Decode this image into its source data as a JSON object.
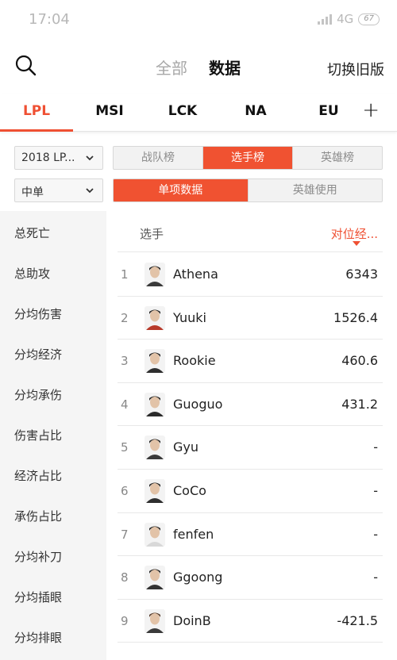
{
  "status_bar": {
    "time": "17:04",
    "network": "4G",
    "battery": "67"
  },
  "header": {
    "tab_all": "全部",
    "tab_data": "数据",
    "old_version": "切换旧版"
  },
  "league_tabs": [
    "LPL",
    "MSI",
    "LCK",
    "NA",
    "EU"
  ],
  "add_label": "+",
  "filters": {
    "season": "2018 LP...",
    "position": "中单",
    "ranking_tabs": [
      "战队榜",
      "选手榜",
      "英雄榜"
    ],
    "data_tabs": [
      "单项数据",
      "英雄使用"
    ]
  },
  "sidebar": {
    "items": [
      "总死亡",
      "总助攻",
      "分均伤害",
      "分均经济",
      "分均承伤",
      "伤害占比",
      "经济占比",
      "承伤占比",
      "分均补刀",
      "分均插眼",
      "分均排眼"
    ]
  },
  "table": {
    "col_player": "选手",
    "col_sort": "对位经...",
    "rows": [
      {
        "rank": "1",
        "name": "Athena",
        "value": "6343"
      },
      {
        "rank": "2",
        "name": "Yuuki",
        "value": "1526.4"
      },
      {
        "rank": "3",
        "name": "Rookie",
        "value": "460.6"
      },
      {
        "rank": "4",
        "name": "Guoguo",
        "value": "431.2"
      },
      {
        "rank": "5",
        "name": "Gyu",
        "value": "-"
      },
      {
        "rank": "6",
        "name": "CoCo",
        "value": "-"
      },
      {
        "rank": "7",
        "name": "fenfen",
        "value": "-"
      },
      {
        "rank": "8",
        "name": "Ggoong",
        "value": "-"
      },
      {
        "rank": "9",
        "name": "DoinB",
        "value": "-421.5"
      }
    ]
  },
  "colors": {
    "accent": "#ef5033",
    "sidebar_bg": "#f5f5f5",
    "muted": "#a8a8a8"
  }
}
